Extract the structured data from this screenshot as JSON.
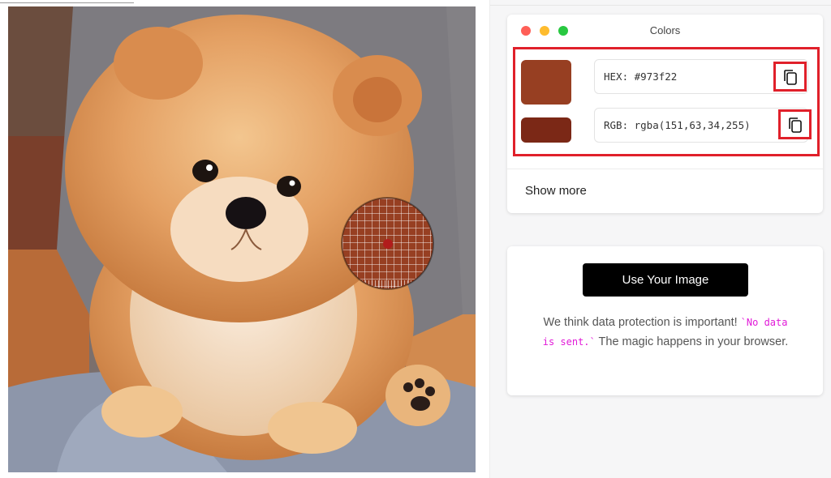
{
  "colors_card": {
    "title": "Colors",
    "swatch_primary": "#973f22",
    "swatch_secondary": "#7b2816",
    "hex_text": "HEX: #973f22",
    "rgb_text": "RGB: rgba(151,63,34,255)",
    "copy_icon": "copy-icon",
    "show_more_label": "Show more"
  },
  "info_card": {
    "button_label": "Use Your Image",
    "note_before": "We think data protection is important! ",
    "note_code": "`No data is sent.`",
    "note_after": " The magic happens in your browser."
  },
  "colors": {
    "highlight": "#e0202a",
    "picked": "#973f22",
    "code_text": "#e11ad8"
  }
}
